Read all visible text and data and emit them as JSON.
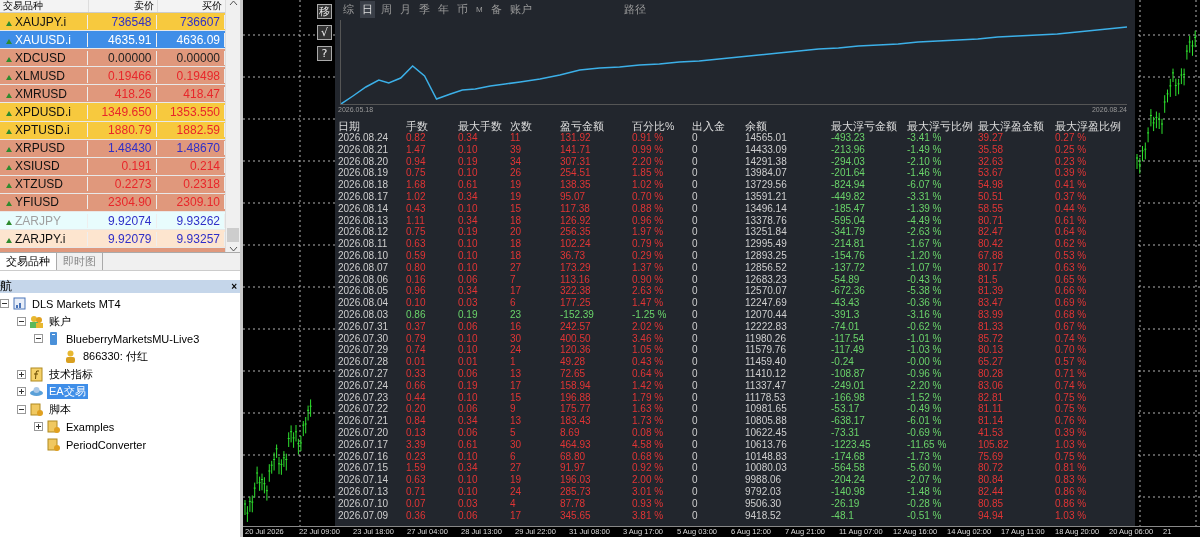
{
  "market_watch": {
    "columns": [
      "交易品种",
      "卖价",
      "买价"
    ],
    "rows": [
      {
        "symbol": "XAUJPY.i",
        "bid": "736548",
        "ask": "736607",
        "color": "#f7c93e",
        "up": true,
        "down": false,
        "selected": false,
        "disabled": false
      },
      {
        "symbol": "XAUUSD.i",
        "bid": "4635.91",
        "ask": "4636.09",
        "color": "#3f8ee8",
        "up": true,
        "down": false,
        "selected": true,
        "disabled": false
      },
      {
        "symbol": "XDCUSD",
        "bid": "0.00000",
        "ask": "0.00000",
        "color": "#e0987c",
        "up": false,
        "down": false,
        "selected": false,
        "disabled": false
      },
      {
        "symbol": "XLMUSD",
        "bid": "0.19466",
        "ask": "0.19498",
        "color": "#e0987c",
        "up": false,
        "down": true,
        "selected": false,
        "disabled": false
      },
      {
        "symbol": "XMRUSD",
        "bid": "418.26",
        "ask": "418.47",
        "color": "#e0987c",
        "up": false,
        "down": true,
        "selected": false,
        "disabled": false
      },
      {
        "symbol": "XPDUSD.i",
        "bid": "1349.650",
        "ask": "1353.550",
        "color": "#f7c93e",
        "up": false,
        "down": true,
        "selected": false,
        "disabled": false
      },
      {
        "symbol": "XPTUSD.i",
        "bid": "1880.79",
        "ask": "1882.59",
        "color": "#f7c93e",
        "up": false,
        "down": true,
        "selected": false,
        "disabled": false
      },
      {
        "symbol": "XRPUSD",
        "bid": "1.48430",
        "ask": "1.48670",
        "color": "#e0987c",
        "up": true,
        "down": false,
        "selected": false,
        "disabled": false
      },
      {
        "symbol": "XSIUSD",
        "bid": "0.191",
        "ask": "0.214",
        "color": "#e0987c",
        "up": false,
        "down": true,
        "selected": false,
        "disabled": false
      },
      {
        "symbol": "XTZUSD",
        "bid": "0.2273",
        "ask": "0.2318",
        "color": "#e0987c",
        "up": false,
        "down": true,
        "selected": false,
        "disabled": false
      },
      {
        "symbol": "YFIUSD",
        "bid": "2304.90",
        "ask": "2309.10",
        "color": "#e0987c",
        "up": false,
        "down": true,
        "selected": false,
        "disabled": false
      },
      {
        "symbol": "ZARJPY",
        "bid": "9.92074",
        "ask": "9.93262",
        "color": "#e8fcfd",
        "up": true,
        "down": false,
        "selected": false,
        "disabled": true
      },
      {
        "symbol": "ZARJPY.i",
        "bid": "9.92079",
        "ask": "9.93257",
        "color": "#fde5cf",
        "up": true,
        "down": false,
        "selected": false,
        "disabled": false
      }
    ]
  },
  "market_tabs": [
    {
      "label": "交易品种",
      "selected": true
    },
    {
      "label": "即时图",
      "selected": false
    }
  ],
  "navigator": {
    "title": "航",
    "close_label": "×",
    "tree": [
      {
        "label": "DLS Markets MT4",
        "kind": "terminal",
        "selected": false,
        "expanded": true,
        "children": [
          {
            "label": "账户",
            "kind": "accounts",
            "selected": false,
            "expanded": true,
            "children": [
              {
                "label": "BlueberryMarketsMU-Live3",
                "kind": "server",
                "selected": false,
                "expanded": true,
                "children": [
                  {
                    "label": "866330: 付红",
                    "kind": "account",
                    "selected": false
                  }
                ]
              }
            ]
          },
          {
            "label": "技术指标",
            "kind": "indicators",
            "selected": false,
            "expanded": false
          },
          {
            "label": "EA交易",
            "kind": "experts",
            "selected": true,
            "expanded": false
          },
          {
            "label": "脚本",
            "kind": "scripts",
            "selected": false,
            "expanded": true,
            "children": [
              {
                "label": "Examples",
                "kind": "script",
                "selected": false,
                "expanded": false
              },
              {
                "label": "PeriodConverter",
                "kind": "script",
                "selected": false
              }
            ]
          }
        ]
      }
    ]
  },
  "tool_buttons": [
    "移",
    "√",
    "?"
  ],
  "report": {
    "tabs": [
      {
        "label": "综",
        "selected": false
      },
      {
        "label": "日",
        "selected": true
      },
      {
        "label": "周",
        "selected": false
      },
      {
        "label": "月",
        "selected": false
      },
      {
        "label": "季",
        "selected": false
      },
      {
        "label": "年",
        "selected": false
      },
      {
        "label": "币",
        "selected": false
      },
      {
        "label": "M",
        "selected": false
      },
      {
        "label": "备",
        "selected": false
      },
      {
        "label": "账户",
        "selected": false
      }
    ],
    "path_label": "路径",
    "equity_start_date": "2026.05.18",
    "equity_end_date": "2026.08.24",
    "columns": [
      "日期",
      "手数",
      "最大手数",
      "次数",
      "盈亏金额",
      "百分比%",
      "出入金",
      "余额",
      "最大浮亏金额",
      "最大浮亏比例",
      "最大浮盈金额",
      "最大浮盈比例"
    ],
    "rows": [
      {
        "kind": "profit",
        "cells": [
          "2026.08.24",
          "0.82",
          "0.34",
          "11",
          "131.92",
          "0.91 %",
          "0",
          "14565.01",
          "-493.23",
          "-3.41 %",
          "39.27",
          "0.27 %"
        ]
      },
      {
        "kind": "profit",
        "cells": [
          "2026.08.21",
          "1.47",
          "0.10",
          "39",
          "141.71",
          "0.99 %",
          "0",
          "14433.09",
          "-213.96",
          "-1.49 %",
          "35.58",
          "0.25 %"
        ]
      },
      {
        "kind": "profit",
        "cells": [
          "2026.08.20",
          "0.94",
          "0.19",
          "34",
          "307.31",
          "2.20 %",
          "0",
          "14291.38",
          "-294.03",
          "-2.10 %",
          "32.63",
          "0.23 %"
        ]
      },
      {
        "kind": "profit",
        "cells": [
          "2026.08.19",
          "0.75",
          "0.10",
          "26",
          "254.51",
          "1.85 %",
          "0",
          "13984.07",
          "-201.64",
          "-1.46 %",
          "53.67",
          "0.39 %"
        ]
      },
      {
        "kind": "profit",
        "cells": [
          "2026.08.18",
          "1.68",
          "0.61",
          "19",
          "138.35",
          "1.02 %",
          "0",
          "13729.56",
          "-824.94",
          "-6.07 %",
          "54.98",
          "0.41 %"
        ]
      },
      {
        "kind": "profit",
        "cells": [
          "2026.08.17",
          "1.02",
          "0.34",
          "19",
          "95.07",
          "0.70 %",
          "0",
          "13591.21",
          "-449.82",
          "-3.31 %",
          "50.51",
          "0.37 %"
        ]
      },
      {
        "kind": "profit",
        "cells": [
          "2026.08.14",
          "0.43",
          "0.10",
          "15",
          "117.38",
          "0.88 %",
          "0",
          "13496.14",
          "-185.47",
          "-1.39 %",
          "58.55",
          "0.44 %"
        ]
      },
      {
        "kind": "profit",
        "cells": [
          "2026.08.13",
          "1.11",
          "0.34",
          "18",
          "126.92",
          "0.96 %",
          "0",
          "13378.76",
          "-595.04",
          "-4.49 %",
          "80.71",
          "0.61 %"
        ]
      },
      {
        "kind": "profit",
        "cells": [
          "2026.08.12",
          "0.75",
          "0.19",
          "20",
          "256.35",
          "1.97 %",
          "0",
          "13251.84",
          "-341.79",
          "-2.63 %",
          "82.47",
          "0.64 %"
        ]
      },
      {
        "kind": "profit",
        "cells": [
          "2026.08.11",
          "0.63",
          "0.10",
          "18",
          "102.24",
          "0.79 %",
          "0",
          "12995.49",
          "-214.81",
          "-1.67 %",
          "80.42",
          "0.62 %"
        ]
      },
      {
        "kind": "profit",
        "cells": [
          "2026.08.10",
          "0.59",
          "0.10",
          "18",
          "36.73",
          "0.29 %",
          "0",
          "12893.25",
          "-154.76",
          "-1.20 %",
          "67.88",
          "0.53 %"
        ]
      },
      {
        "kind": "profit",
        "cells": [
          "2026.08.07",
          "0.80",
          "0.10",
          "27",
          "173.29",
          "1.37 %",
          "0",
          "12856.52",
          "-137.72",
          "-1.07 %",
          "80.17",
          "0.63 %"
        ]
      },
      {
        "kind": "profit",
        "cells": [
          "2026.08.06",
          "0.16",
          "0.06",
          "7",
          "113.16",
          "0.90 %",
          "0",
          "12683.23",
          "-54.89",
          "-0.43 %",
          "81.5",
          "0.65 %"
        ]
      },
      {
        "kind": "profit",
        "cells": [
          "2026.08.05",
          "0.96",
          "0.34",
          "17",
          "322.38",
          "2.63 %",
          "0",
          "12570.07",
          "-672.36",
          "-5.38 %",
          "81.39",
          "0.66 %"
        ]
      },
      {
        "kind": "profit",
        "cells": [
          "2026.08.04",
          "0.10",
          "0.03",
          "6",
          "177.25",
          "1.47 %",
          "0",
          "12247.69",
          "-43.43",
          "-0.36 %",
          "83.47",
          "0.69 %"
        ]
      },
      {
        "kind": "loss",
        "cells": [
          "2026.08.03",
          "0.86",
          "0.19",
          "23",
          "-152.39",
          "-1.25 %",
          "0",
          "12070.44",
          "-391.3",
          "-3.16 %",
          "83.99",
          "0.68 %"
        ]
      },
      {
        "kind": "profit",
        "cells": [
          "2026.07.31",
          "0.37",
          "0.06",
          "16",
          "242.57",
          "2.02 %",
          "0",
          "12222.83",
          "-74.01",
          "-0.62 %",
          "81.33",
          "0.67 %"
        ]
      },
      {
        "kind": "profit",
        "cells": [
          "2026.07.30",
          "0.79",
          "0.10",
          "30",
          "400.50",
          "3.46 %",
          "0",
          "11980.26",
          "-117.54",
          "-1.01 %",
          "85.72",
          "0.74 %"
        ]
      },
      {
        "kind": "profit",
        "cells": [
          "2026.07.29",
          "0.74",
          "0.10",
          "24",
          "120.36",
          "1.05 %",
          "0",
          "11579.76",
          "-117.49",
          "-1.03 %",
          "80.13",
          "0.70 %"
        ]
      },
      {
        "kind": "profit",
        "cells": [
          "2026.07.28",
          "0.01",
          "0.01",
          "1",
          "49.28",
          "0.43 %",
          "0",
          "11459.40",
          "-0.24",
          "-0.00 %",
          "65.27",
          "0.57 %"
        ]
      },
      {
        "kind": "profit",
        "cells": [
          "2026.07.27",
          "0.33",
          "0.06",
          "13",
          "72.65",
          "0.64 %",
          "0",
          "11410.12",
          "-108.87",
          "-0.96 %",
          "80.28",
          "0.71 %"
        ]
      },
      {
        "kind": "profit",
        "cells": [
          "2026.07.24",
          "0.66",
          "0.19",
          "17",
          "158.94",
          "1.42 %",
          "0",
          "11337.47",
          "-249.01",
          "-2.20 %",
          "83.06",
          "0.74 %"
        ]
      },
      {
        "kind": "profit",
        "cells": [
          "2026.07.23",
          "0.44",
          "0.10",
          "15",
          "196.88",
          "1.79 %",
          "0",
          "11178.53",
          "-166.98",
          "-1.52 %",
          "82.81",
          "0.75 %"
        ]
      },
      {
        "kind": "profit",
        "cells": [
          "2026.07.22",
          "0.20",
          "0.06",
          "9",
          "175.77",
          "1.63 %",
          "0",
          "10981.65",
          "-53.17",
          "-0.49 %",
          "81.11",
          "0.75 %"
        ]
      },
      {
        "kind": "profit",
        "cells": [
          "2026.07.21",
          "0.84",
          "0.34",
          "13",
          "183.43",
          "1.73 %",
          "0",
          "10805.88",
          "-638.17",
          "-6.01 %",
          "81.14",
          "0.76 %"
        ]
      },
      {
        "kind": "profit",
        "cells": [
          "2026.07.20",
          "0.13",
          "0.06",
          "5",
          "8.69",
          "0.08 %",
          "0",
          "10622.45",
          "-73.31",
          "-0.69 %",
          "41.53",
          "0.39 %"
        ]
      },
      {
        "kind": "profit",
        "cells": [
          "2026.07.17",
          "3.39",
          "0.61",
          "30",
          "464.93",
          "4.58 %",
          "0",
          "10613.76",
          "-1223.45",
          "-11.65 %",
          "105.82",
          "1.03 %"
        ]
      },
      {
        "kind": "profit",
        "cells": [
          "2026.07.16",
          "0.23",
          "0.10",
          "6",
          "68.80",
          "0.68 %",
          "0",
          "10148.83",
          "-174.68",
          "-1.73 %",
          "75.69",
          "0.75 %"
        ]
      },
      {
        "kind": "profit",
        "cells": [
          "2026.07.15",
          "1.59",
          "0.34",
          "27",
          "91.97",
          "0.92 %",
          "0",
          "10080.03",
          "-564.58",
          "-5.60 %",
          "80.72",
          "0.81 %"
        ]
      },
      {
        "kind": "profit",
        "cells": [
          "2026.07.14",
          "0.63",
          "0.10",
          "19",
          "196.03",
          "2.00 %",
          "0",
          "9988.06",
          "-204.24",
          "-2.07 %",
          "80.84",
          "0.83 %"
        ]
      },
      {
        "kind": "profit",
        "cells": [
          "2026.07.13",
          "0.71",
          "0.10",
          "24",
          "285.73",
          "3.01 %",
          "0",
          "9792.03",
          "-140.98",
          "-1.48 %",
          "82.44",
          "0.86 %"
        ]
      },
      {
        "kind": "profit",
        "cells": [
          "2026.07.10",
          "0.07",
          "0.03",
          "4",
          "87.78",
          "0.93 %",
          "0",
          "9506.30",
          "-26.19",
          "-0.28 %",
          "80.85",
          "0.86 %"
        ]
      },
      {
        "kind": "profit",
        "cells": [
          "2026.07.09",
          "0.36",
          "0.06",
          "17",
          "345.65",
          "3.81 %",
          "0",
          "9418.52",
          "-48.1",
          "-0.51 %",
          "94.94",
          "1.03 %"
        ]
      }
    ]
  },
  "time_axis": [
    "20 Jul 2026",
    "22 Jul 09:00",
    "23 Jul 18:00",
    "27 Jul 04:00",
    "28 Jul 13:00",
    "29 Jul 22:00",
    "31 Jul 08:00",
    "3 Aug 17:00",
    "5 Aug 03:00",
    "6 Aug 12:00",
    "7 Aug 21:00",
    "11 Aug 07:00",
    "12 Aug 16:00",
    "14 Aug 02:00",
    "17 Aug 11:00",
    "18 Aug 20:00",
    "20 Aug 06:00",
    "21"
  ]
}
